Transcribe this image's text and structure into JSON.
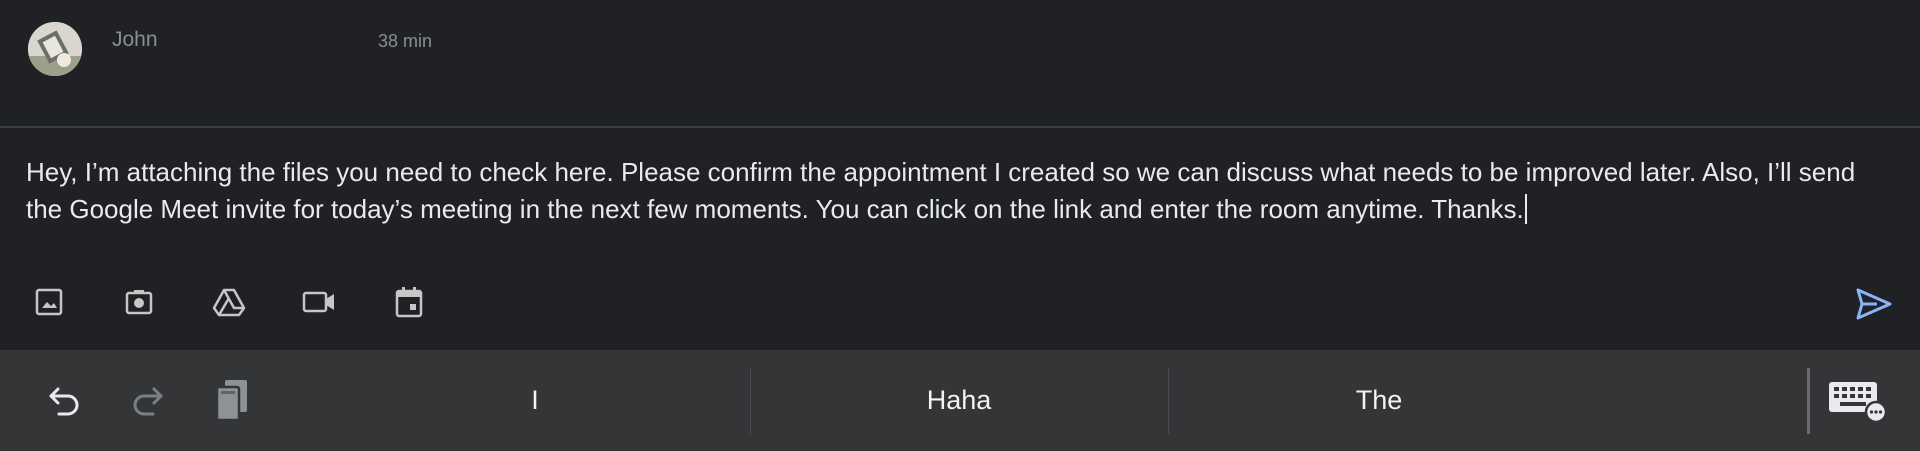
{
  "header": {
    "sender": "John",
    "time": "38 min"
  },
  "compose": {
    "message": "Hey, I’m attaching the files you need to check here. Please confirm the appointment I created so we can discuss what needs to be improved later. Also, I’ll send the Google Meet invite for today’s meeting in the next few moments. You can click on the link and enter the room anytime. Thanks.",
    "attachments": [
      {
        "name": "image",
        "icon": "image-icon"
      },
      {
        "name": "camera",
        "icon": "camera-icon"
      },
      {
        "name": "drive",
        "icon": "drive-icon"
      },
      {
        "name": "video",
        "icon": "video-icon"
      },
      {
        "name": "calendar",
        "icon": "calendar-icon"
      }
    ],
    "send_icon": "send-icon",
    "accent_color": "#8ab4f8"
  },
  "keyboard": {
    "tools": [
      "undo-icon",
      "redo-icon",
      "clipboard-icon"
    ],
    "suggestions": [
      "I",
      "Haha",
      "The"
    ],
    "switch_icon": "keyboard-icon"
  }
}
